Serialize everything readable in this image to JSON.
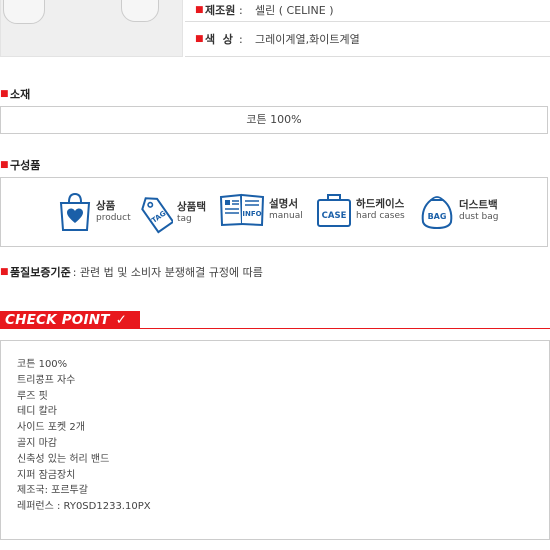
{
  "spec": {
    "rows": [
      {
        "label": "제조원",
        "colon": ":",
        "value": "셀린 ( CELINE )"
      },
      {
        "label": "색  상",
        "colon": ":",
        "value": "그레이계열,화이트계열"
      }
    ]
  },
  "material": {
    "title": "소재",
    "value": "코튼 100%"
  },
  "components": {
    "title": "구성품",
    "items": [
      {
        "ko": "상품",
        "en": "product",
        "icon": "shopping-bag-icon"
      },
      {
        "ko": "상품택",
        "en": "tag",
        "icon": "tag-icon"
      },
      {
        "ko": "설명서",
        "en": "manual",
        "icon": "manual-book-icon"
      },
      {
        "ko": "하드케이스",
        "en": "hard cases",
        "icon": "case-icon"
      },
      {
        "ko": "더스트백",
        "en": "dust bag",
        "icon": "dust-bag-icon"
      }
    ],
    "icon_text": {
      "tag": "TAG",
      "info": "INFO",
      "case": "CASE",
      "bag": "BAG"
    }
  },
  "quality": {
    "label": "품질보증기준",
    "value": ": 관련 법 및 소비자 분쟁해결 규정에 따름"
  },
  "check_point": {
    "title": "CHECK POINT",
    "check_mark": "✓",
    "items": [
      "코튼 100%",
      "트리콩프 자수",
      "루즈 핏",
      "테디 칼라",
      "사이드 포켓 2개",
      "골지 마감",
      "신축성 있는 허리 밴드",
      "지퍼 잠금장치",
      "제조국: 포르투갈",
      "레퍼런스 : RY0SD1233.10PX"
    ]
  },
  "colors": {
    "accent": "#e8181d",
    "icon_blue": "#1a5fa8",
    "border": "#cccccc"
  }
}
